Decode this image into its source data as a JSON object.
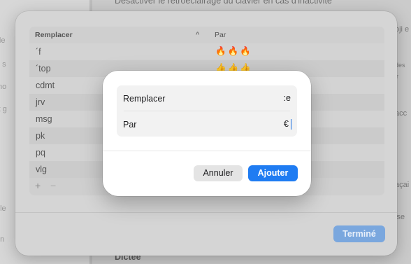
{
  "background": {
    "top_text": "Désactiver le rétroéclairage du clavier en cas d'inactivité",
    "section_label": "Dictée",
    "sidebar_fragments": [
      "ille",
      "é s",
      "mo",
      "rt g",
      "e",
      "r",
      "ple",
      "en"
    ],
    "right_fragments": [
      "oji e",
      "des",
      "ir",
      "acc",
      "açai",
      "ise"
    ]
  },
  "sheet": {
    "columns": {
      "replace": "Remplacer",
      "with": "Par"
    },
    "sort_icon": "chevron-up-icon",
    "rows": [
      {
        "replace": "´f",
        "with": "🔥🔥🔥"
      },
      {
        "replace": "´top",
        "with": "👍👍👍"
      },
      {
        "replace": "cdmt",
        "with": ""
      },
      {
        "replace": "jrv",
        "with": ""
      },
      {
        "replace": "msg",
        "with": ""
      },
      {
        "replace": "pk",
        "with": ""
      },
      {
        "replace": "pq",
        "with": ""
      },
      {
        "replace": "vlg",
        "with": ""
      }
    ],
    "add_label": "+",
    "remove_label": "−",
    "done_label": "Terminé"
  },
  "dialog": {
    "replace_label": "Remplacer",
    "replace_value": ":e",
    "with_label": "Par",
    "with_value": "€",
    "cancel_label": "Annuler",
    "add_label": "Ajouter"
  },
  "colors": {
    "accent": "#1f7cf2",
    "accent_disabled": "#7aa7de"
  }
}
